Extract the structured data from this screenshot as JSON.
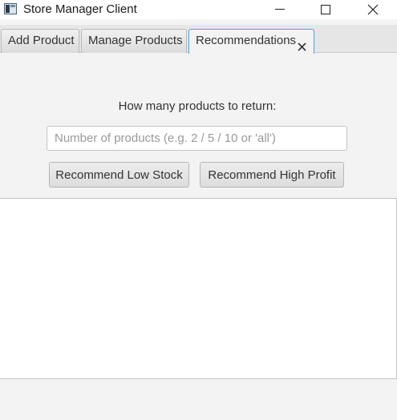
{
  "window": {
    "title": "Store Manager Client",
    "icons": {
      "app": "app-window-icon",
      "minimize": "minimize-icon",
      "maximize": "maximize-icon",
      "close": "close-icon"
    }
  },
  "tabs": [
    {
      "label": "Add Product",
      "selected": false
    },
    {
      "label": "Manage Products",
      "selected": false
    },
    {
      "label": "Recommendations",
      "selected": true,
      "closable": true
    }
  ],
  "recommendations": {
    "prompt_label": "How many products to return:",
    "count_input": {
      "value": "",
      "placeholder": "Number of products (e.g. 2 / 5 / 10 or 'all')"
    },
    "buttons": {
      "low_stock": "Recommend Low Stock",
      "high_profit": "Recommend High Profit"
    },
    "results_text": ""
  },
  "colors": {
    "accent_tab_border": "#46a6e0",
    "background": "#f3f3f3"
  }
}
